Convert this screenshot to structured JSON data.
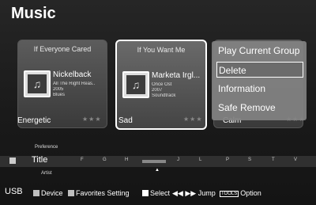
{
  "header": {
    "title": "Music"
  },
  "cards": [
    {
      "heading": "If Everyone Cared",
      "artist": "Nickelback",
      "lines": [
        "All The Right Reas..",
        "2005",
        "Blues"
      ],
      "mood": "Energetic"
    },
    {
      "heading": "If You Want Me",
      "artist": "Marketa Irgl...",
      "lines": [
        "Once Ost",
        "2007",
        "Soundtrack"
      ],
      "mood": "Sad"
    },
    {
      "heading": "",
      "artist": "",
      "lines": [
        "",
        "",
        ""
      ],
      "mood": "Calm"
    }
  ],
  "stars": "★★★",
  "context_menu": {
    "items": [
      "Play Current Group",
      "Delete",
      "Information",
      "Safe Remove"
    ],
    "active_index": 1
  },
  "sort_bar": {
    "top_label": "Preference",
    "current": "Title",
    "bottom_label": "Artist",
    "letters": [
      "F",
      "G",
      "H",
      "J",
      "L",
      "P",
      "S",
      "T",
      "V"
    ]
  },
  "footer": {
    "source": "USB",
    "items": [
      {
        "label": "Device",
        "color": "#bfbfbf"
      },
      {
        "label": "Favorites Setting",
        "color": "#bfbfbf"
      },
      {
        "label": "Select",
        "color": "#ffffff"
      }
    ],
    "jump_label": "Jump",
    "tools_label": "TOOLS",
    "option_label": "Option"
  }
}
